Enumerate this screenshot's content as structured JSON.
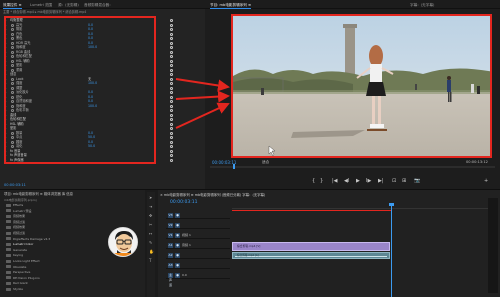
{
  "topbar": {
    "tabs": [
      {
        "label": "效果控件 ≡",
        "active": true
      },
      {
        "label": "Lumetri 范围",
        "active": false
      },
      {
        "label": "源：(无剪辑)",
        "active": false
      },
      {
        "label": "音频剪辑混合器：",
        "active": false
      }
    ],
    "program_tab": "节目: mb电影剪辑序列 ≡",
    "program_tab2": "字幕：(无字幕)"
  },
  "effect_controls": {
    "sequence_label": "主要 * 综合剪辑.mp4  ▸  mb电影剪辑序列 * 综合剪辑.mp4",
    "rows": [
      {
        "name": "均衡整理",
        "value": "",
        "section": true
      },
      {
        "name": "高光",
        "value": "0.0"
      },
      {
        "name": "阴影",
        "value": "0.0"
      },
      {
        "name": "白色",
        "value": "0.0"
      },
      {
        "name": "黑色",
        "value": "0.0"
      },
      {
        "name": "HDR 高光",
        "value": "0.0"
      },
      {
        "name": "饱和度",
        "value": "100.0"
      },
      {
        "name": "RGB 曲线",
        "value": ""
      },
      {
        "name": "色轮和匹配",
        "value": ""
      },
      {
        "name": "HSL 辅助",
        "value": ""
      },
      {
        "name": "晕影",
        "value": ""
      },
      {
        "name": "重置",
        "value": ""
      },
      {
        "name": "创意",
        "value": "",
        "section": true
      },
      {
        "name": "Look",
        "value": "无"
      },
      {
        "name": "强度",
        "value": "100.0"
      },
      {
        "name": "调整",
        "value": ""
      },
      {
        "name": "淡化胶片",
        "value": "0.0"
      },
      {
        "name": "锐化",
        "value": "0.0"
      },
      {
        "name": "自然饱和度",
        "value": "0.0"
      },
      {
        "name": "饱和度",
        "value": "100.0"
      },
      {
        "name": "色彩平衡",
        "value": ""
      },
      {
        "name": "曲线",
        "value": "",
        "section": true
      },
      {
        "name": "色轮和匹配",
        "value": "",
        "section": true
      },
      {
        "name": "HSL 辅助",
        "value": "",
        "section": true
      },
      {
        "name": "晕影",
        "value": "",
        "section": true
      },
      {
        "name": "数量",
        "value": "0.0"
      },
      {
        "name": "中点",
        "value": "50.0"
      },
      {
        "name": "圆度",
        "value": "0.0"
      },
      {
        "name": "羽化",
        "value": "50.0"
      },
      {
        "name": "fx 音量",
        "value": "",
        "section": true
      },
      {
        "name": "fx 声道音量",
        "value": "",
        "section": true
      },
      {
        "name": "fx 声像器",
        "value": "",
        "section": true
      }
    ],
    "timecode": "00:00:03:11"
  },
  "program_monitor": {
    "timecode": "00:00:03:11",
    "fit_label": "适合",
    "duration": "00:00:13:12",
    "controls": [
      "{",
      "}",
      "|◀",
      "◀I",
      "▶",
      "I▶",
      "▶|",
      "⊡",
      "⊞",
      "📷",
      "+"
    ]
  },
  "project": {
    "header": "项目: mb电影剪辑序列 ≡   媒体浏览器   库   信息",
    "path": "mb电影剪辑序列.prproj",
    "items": [
      {
        "label": "Effects"
      },
      {
        "label": "Lumetri 预设"
      },
      {
        "label": "音频效果"
      },
      {
        "label": "音频过渡"
      },
      {
        "label": "视频效果"
      },
      {
        "label": "视频过渡"
      },
      {
        "label": "Digieffects Damage v4.3"
      },
      {
        "label": "Lumetri Color",
        "selected": true
      },
      {
        "label": "Generate"
      },
      {
        "label": "Keying"
      },
      {
        "label": "Looks Light Effect"
      },
      {
        "label": "Obsolete"
      },
      {
        "label": "Perspective"
      },
      {
        "label": "RE:Vision Plug-ins"
      },
      {
        "label": "Red Giant"
      },
      {
        "label": "Stylize"
      }
    ]
  },
  "timeline": {
    "tab": "× mb电影剪辑序列 ≡   mb电影剪辑序列 (音频已分离)   字幕：(无字幕)",
    "timecode": "00:00:03:11",
    "tracks": [
      {
        "name": "V3",
        "label": ""
      },
      {
        "name": "V2",
        "label": ""
      },
      {
        "name": "V1",
        "label": "视频 1"
      },
      {
        "name": "A1",
        "label": "音频 1"
      },
      {
        "name": "A2",
        "label": ""
      },
      {
        "name": "A3",
        "label": ""
      },
      {
        "name": "主声道",
        "label": "0.0"
      }
    ],
    "clip_video": "综合剪辑.mp4 [V]",
    "clip_audio": "综合剪辑.mp4 [A]"
  },
  "colors": {
    "accent": "#2d8ceb",
    "annotation_red": "#e3261f",
    "value_blue": "#3c9bf0",
    "clip_video": "#9a85c9",
    "clip_audio": "#5d8794"
  }
}
